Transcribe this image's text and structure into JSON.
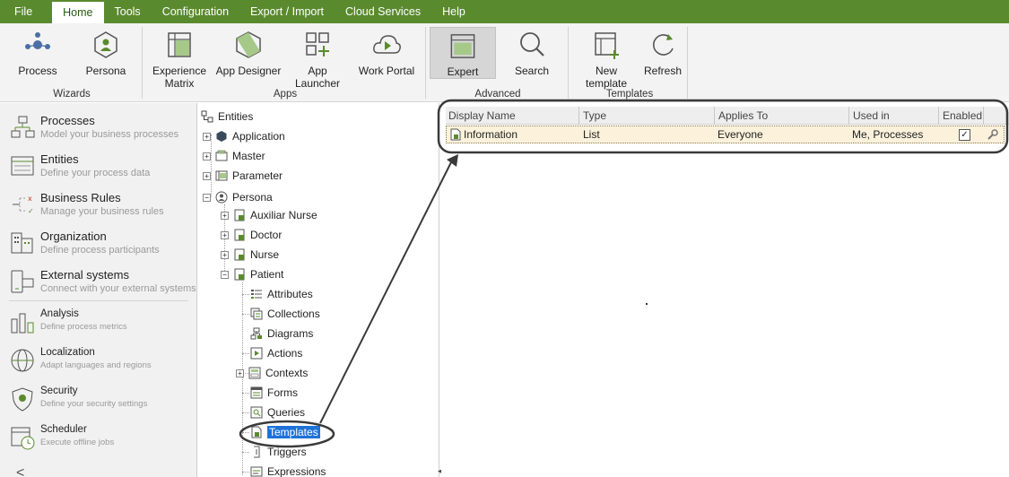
{
  "menu": {
    "file": "File",
    "home": "Home",
    "tools": "Tools",
    "configuration": "Configuration",
    "export_import": "Export / Import",
    "cloud_services": "Cloud Services",
    "help": "Help"
  },
  "ribbon": {
    "process": "Process",
    "persona": "Persona",
    "wizards": "Wizards",
    "experience_matrix": "Experience\nMatrix",
    "app_designer": "App Designer",
    "app_launcher": "App Launcher",
    "work_portal": "Work Portal",
    "apps": "Apps",
    "expert": "Expert",
    "search": "Search",
    "advanced": "Advanced",
    "new_template": "New template",
    "refresh": "Refresh",
    "templates": "Templates"
  },
  "sidebar": {
    "items": [
      {
        "title": "Processes",
        "subtitle": "Model your business processes"
      },
      {
        "title": "Entities",
        "subtitle": "Define your process data"
      },
      {
        "title": "Business Rules",
        "subtitle": "Manage your business rules"
      },
      {
        "title": "Organization",
        "subtitle": "Define process participants"
      },
      {
        "title": "External systems",
        "subtitle": "Connect with your external systems"
      },
      {
        "title": "Analysis",
        "subtitle": "Define process metrics"
      },
      {
        "title": "Localization",
        "subtitle": "Adapt languages and regions"
      },
      {
        "title": "Security",
        "subtitle": "Define your security settings"
      },
      {
        "title": "Scheduler",
        "subtitle": "Execute offline jobs"
      }
    ],
    "collapse_glyph": "<"
  },
  "tree": {
    "root": "Entities",
    "application": "Application",
    "master": "Master",
    "parameter": "Parameter",
    "persona": "Persona",
    "auxiliar_nurse": "Auxiliar Nurse",
    "doctor": "Doctor",
    "nurse": "Nurse",
    "patient": "Patient",
    "attributes": "Attributes",
    "collections": "Collections",
    "diagrams": "Diagrams",
    "actions": "Actions",
    "contexts": "Contexts",
    "forms": "Forms",
    "queries": "Queries",
    "templates": "Templates",
    "triggers": "Triggers",
    "expressions": "Expressions"
  },
  "grid": {
    "columns": [
      "Display Name",
      "Type",
      "Applies To",
      "Used in",
      "Enabled"
    ],
    "rows": [
      {
        "display_name": "Information",
        "type": "List",
        "applies_to": "Everyone",
        "used_in": "Me, Processes",
        "enabled": "✓"
      }
    ]
  },
  "colors": {
    "brand_green": "#5a8a2e",
    "selection_blue": "#1e72d8",
    "row_highlight": "#fcf2dc"
  }
}
